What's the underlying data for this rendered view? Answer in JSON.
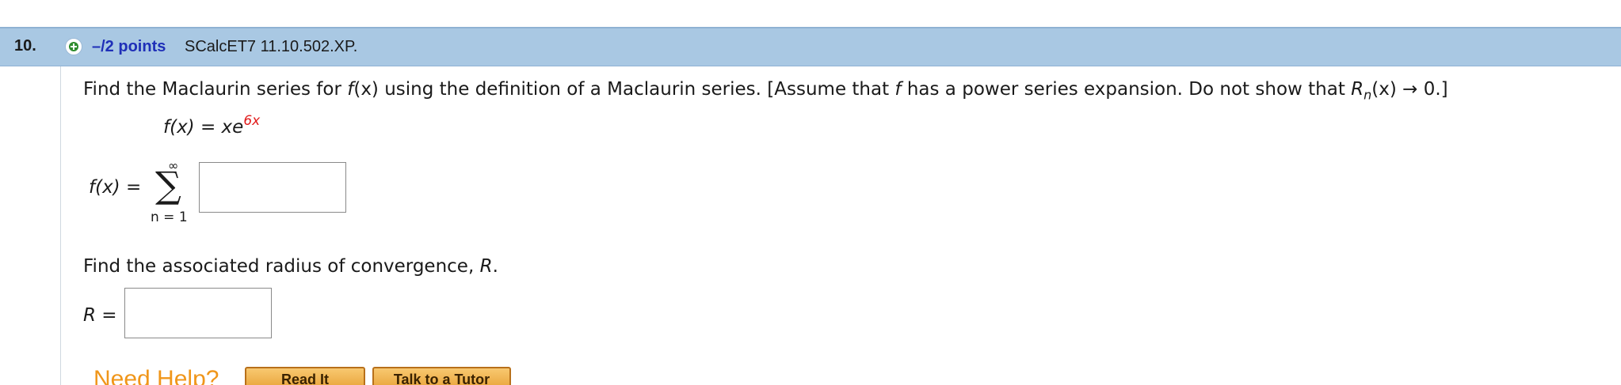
{
  "question": {
    "number": "10.",
    "points": "–/2 points",
    "source": "SCalcET7 11.10.502.XP."
  },
  "instructions": {
    "part1": "Find the Maclaurin series for ",
    "fx": "f",
    "paren_x": "(x)",
    "part2": " using the definition of a Maclaurin series. [Assume that ",
    "f": "f",
    "part3": " has a power series expansion. Do not show that  ",
    "R": "R",
    "n_sub": "n",
    "part4": "(x) → 0.]"
  },
  "given_function": {
    "lhs": "f(x) = xe",
    "exponent": "6x"
  },
  "series_answer": {
    "label": "f(x) =",
    "sigma": "∑",
    "upper_limit": "∞",
    "lower_limit": "n = 1",
    "value": ""
  },
  "radius": {
    "prompt_text": "Find the associated radius of convergence, ",
    "prompt_var": "R",
    "prompt_end": ".",
    "label": "R =",
    "value": ""
  },
  "help": {
    "title": "Need Help?",
    "read_it": "Read It",
    "talk_to_tutor": "Talk to a Tutor"
  },
  "colors": {
    "header_bg": "#a9c8e3",
    "points_text": "#1f2fb8",
    "exponent_red": "#e11b1b",
    "help_orange": "#f0961a"
  }
}
